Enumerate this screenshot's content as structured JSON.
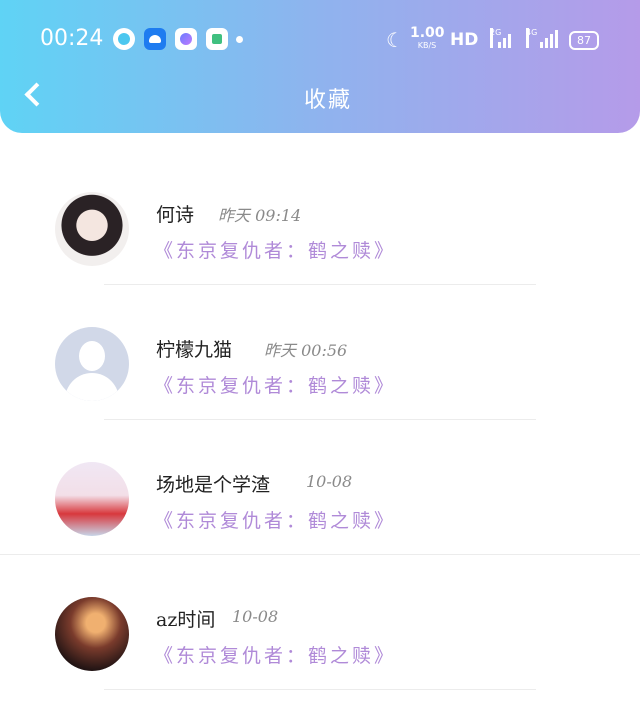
{
  "status_bar": {
    "time": "00:24",
    "speed_value": "1.00",
    "speed_unit": "KB/S",
    "hd_label": "HD",
    "sim1_label": "2G",
    "sim2_label": "4G",
    "battery": "87"
  },
  "header": {
    "title": "收藏"
  },
  "favorites": [
    {
      "name": "何诗",
      "time": "昨天 09:14",
      "work": "《东京复仇者：鹤之赎》"
    },
    {
      "name": "柠檬九猫",
      "time": "昨天 00:56",
      "work": "《东京复仇者：鹤之赎》"
    },
    {
      "name": "场地是个学渣",
      "time": "10-08",
      "work": "《东京复仇者：鹤之赎》"
    },
    {
      "name": "az时间",
      "time": "10-08",
      "work": "《东京复仇者：鹤之赎》"
    }
  ]
}
